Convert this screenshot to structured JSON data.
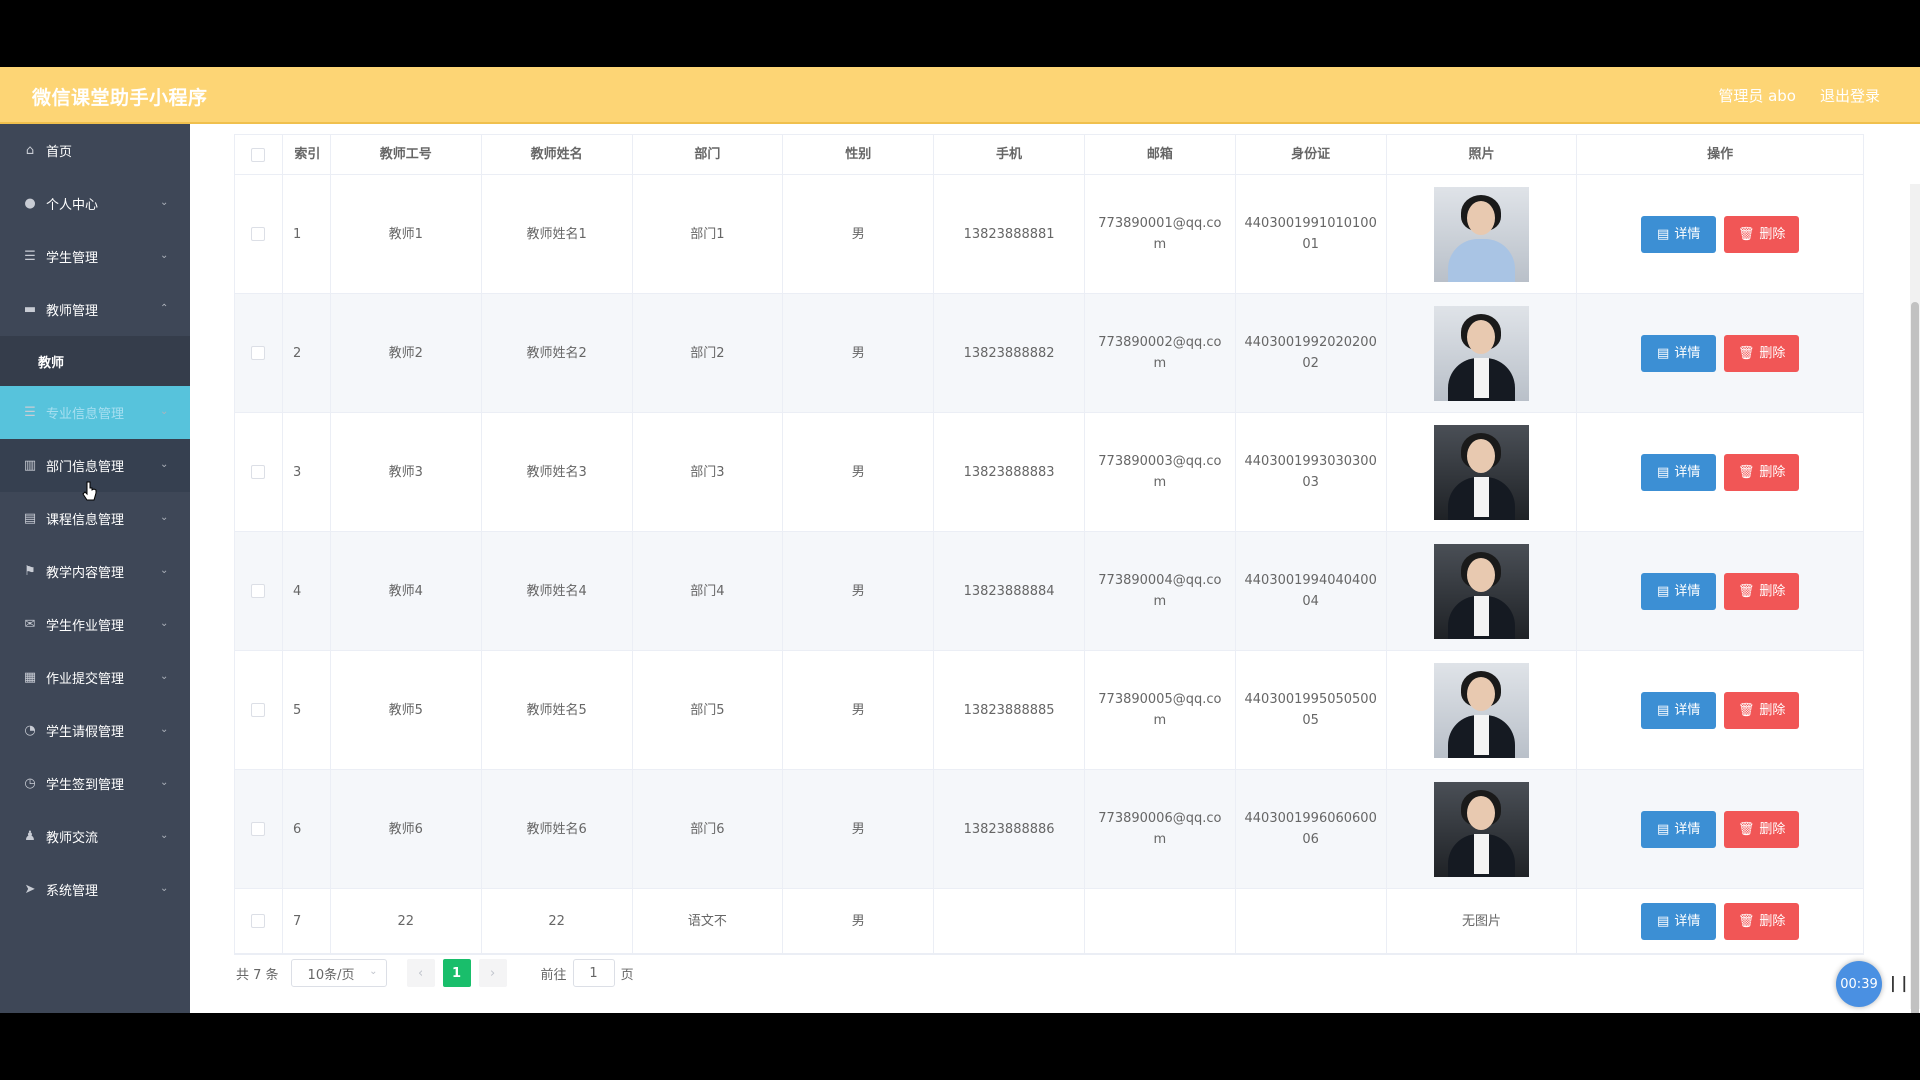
{
  "app": {
    "title": "微信课堂助手小程序",
    "admin_label": "管理员 abo",
    "logout_label": "退出登录",
    "accent_color": "#fdd575",
    "sidebar_color": "#3e4757"
  },
  "sidebar": {
    "items": [
      {
        "label": "首页",
        "icon": "home-icon",
        "chevron": false
      },
      {
        "label": "个人中心",
        "icon": "user-icon",
        "chevron": true
      },
      {
        "label": "学生管理",
        "icon": "list-icon",
        "chevron": true
      },
      {
        "label": "教师管理",
        "icon": "briefcase-icon",
        "chevron": true,
        "expanded": true
      },
      {
        "label": "教师",
        "icon": "",
        "sub": true
      },
      {
        "label": "专业信息管理",
        "icon": "list-icon",
        "chevron": true,
        "active": true
      },
      {
        "label": "部门信息管理",
        "icon": "chart-icon",
        "chevron": true
      },
      {
        "label": "课程信息管理",
        "icon": "document-icon",
        "chevron": true
      },
      {
        "label": "教学内容管理",
        "icon": "flag-icon",
        "chevron": true
      },
      {
        "label": "学生作业管理",
        "icon": "mail-icon",
        "chevron": true
      },
      {
        "label": "作业提交管理",
        "icon": "grid-icon",
        "chevron": true
      },
      {
        "label": "学生请假管理",
        "icon": "compass-icon",
        "chevron": true
      },
      {
        "label": "学生签到管理",
        "icon": "clock-icon",
        "chevron": true
      },
      {
        "label": "教师交流",
        "icon": "person-icon",
        "chevron": true
      },
      {
        "label": "系统管理",
        "icon": "send-icon",
        "chevron": true
      }
    ]
  },
  "table": {
    "headers": [
      "索引",
      "教师工号",
      "教师姓名",
      "部门",
      "性别",
      "手机",
      "邮箱",
      "身份证",
      "照片",
      "操作"
    ],
    "detail_label": "详情",
    "delete_label": "删除",
    "rows": [
      {
        "idx": "1",
        "no": "教师1",
        "name": "教师姓名1",
        "dept": "部门1",
        "sex": "男",
        "phone": "13823888881",
        "email": "773890001@qq.com",
        "id": "440300199101010001",
        "photo": "portrait-woman-light",
        "photo_text": ""
      },
      {
        "idx": "2",
        "no": "教师2",
        "name": "教师姓名2",
        "dept": "部门2",
        "sex": "男",
        "phone": "13823888882",
        "email": "773890002@qq.com",
        "id": "440300199202020002",
        "photo": "portrait-woman-suit",
        "photo_text": ""
      },
      {
        "idx": "3",
        "no": "教师3",
        "name": "教师姓名3",
        "dept": "部门3",
        "sex": "男",
        "phone": "13823888883",
        "email": "773890003@qq.com",
        "id": "440300199303030003",
        "photo": "portrait-man-dark",
        "photo_text": ""
      },
      {
        "idx": "4",
        "no": "教师4",
        "name": "教师姓名4",
        "dept": "部门4",
        "sex": "男",
        "phone": "13823888884",
        "email": "773890004@qq.com",
        "id": "440300199404040004",
        "photo": "portrait-woman-dark",
        "photo_text": ""
      },
      {
        "idx": "5",
        "no": "教师5",
        "name": "教师姓名5",
        "dept": "部门5",
        "sex": "男",
        "phone": "13823888885",
        "email": "773890005@qq.com",
        "id": "440300199505050005",
        "photo": "portrait-woman-suit",
        "photo_text": ""
      },
      {
        "idx": "6",
        "no": "教师6",
        "name": "教师姓名6",
        "dept": "部门6",
        "sex": "男",
        "phone": "13823888886",
        "email": "773890006@qq.com",
        "id": "440300199606060006",
        "photo": "portrait-man-seated",
        "photo_text": ""
      },
      {
        "idx": "7",
        "no": "22",
        "name": "22",
        "dept": "语文不",
        "sex": "男",
        "phone": "",
        "email": "",
        "id": "",
        "photo": "none",
        "photo_text": "无图片"
      }
    ]
  },
  "pagination": {
    "total_label": "共 7 条",
    "page_size": "10条/页",
    "current_page": "1",
    "goto_label": "前往",
    "goto_value": "1",
    "page_suffix": "页"
  },
  "recorder": {
    "time": "00:39",
    "pause_label": "| |"
  }
}
